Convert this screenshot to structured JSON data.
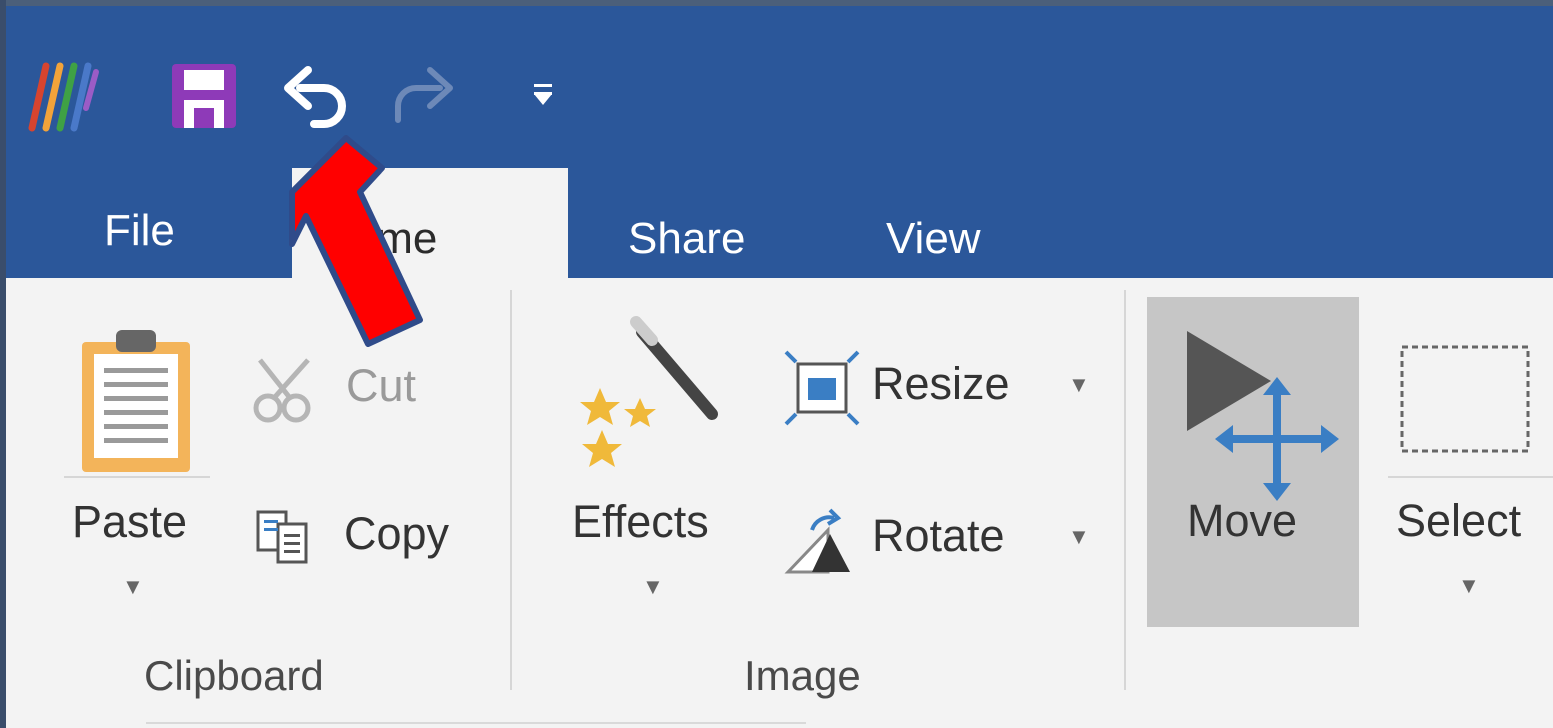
{
  "quick_access": {
    "app_icon": "paint-app-icon",
    "save_icon": "save-icon",
    "undo_icon": "undo-icon",
    "redo_icon": "redo-icon",
    "customize_icon": "customize-qat-icon"
  },
  "tabs": {
    "file": "File",
    "home": "Home",
    "share": "Share",
    "view": "View"
  },
  "clipboard": {
    "paste": "Paste",
    "cut": "Cut",
    "copy": "Copy",
    "group_label": "Clipboard"
  },
  "image": {
    "effects": "Effects",
    "resize": "Resize",
    "rotate": "Rotate",
    "group_label": "Image"
  },
  "tools": {
    "move": "Move",
    "select": "Select"
  },
  "colors": {
    "title_bar": "#2b579a",
    "ribbon": "#f3f3f3",
    "move_active": "#c6c6c6",
    "annotation_arrow": "#ff0000",
    "save_icon": "#8e3ab8",
    "paste_icon": "#f3b45a",
    "effects_star": "#f0b93a",
    "move_arrows": "#3a7ec4"
  },
  "annotation": {
    "type": "arrow",
    "points_to": "undo-button"
  }
}
